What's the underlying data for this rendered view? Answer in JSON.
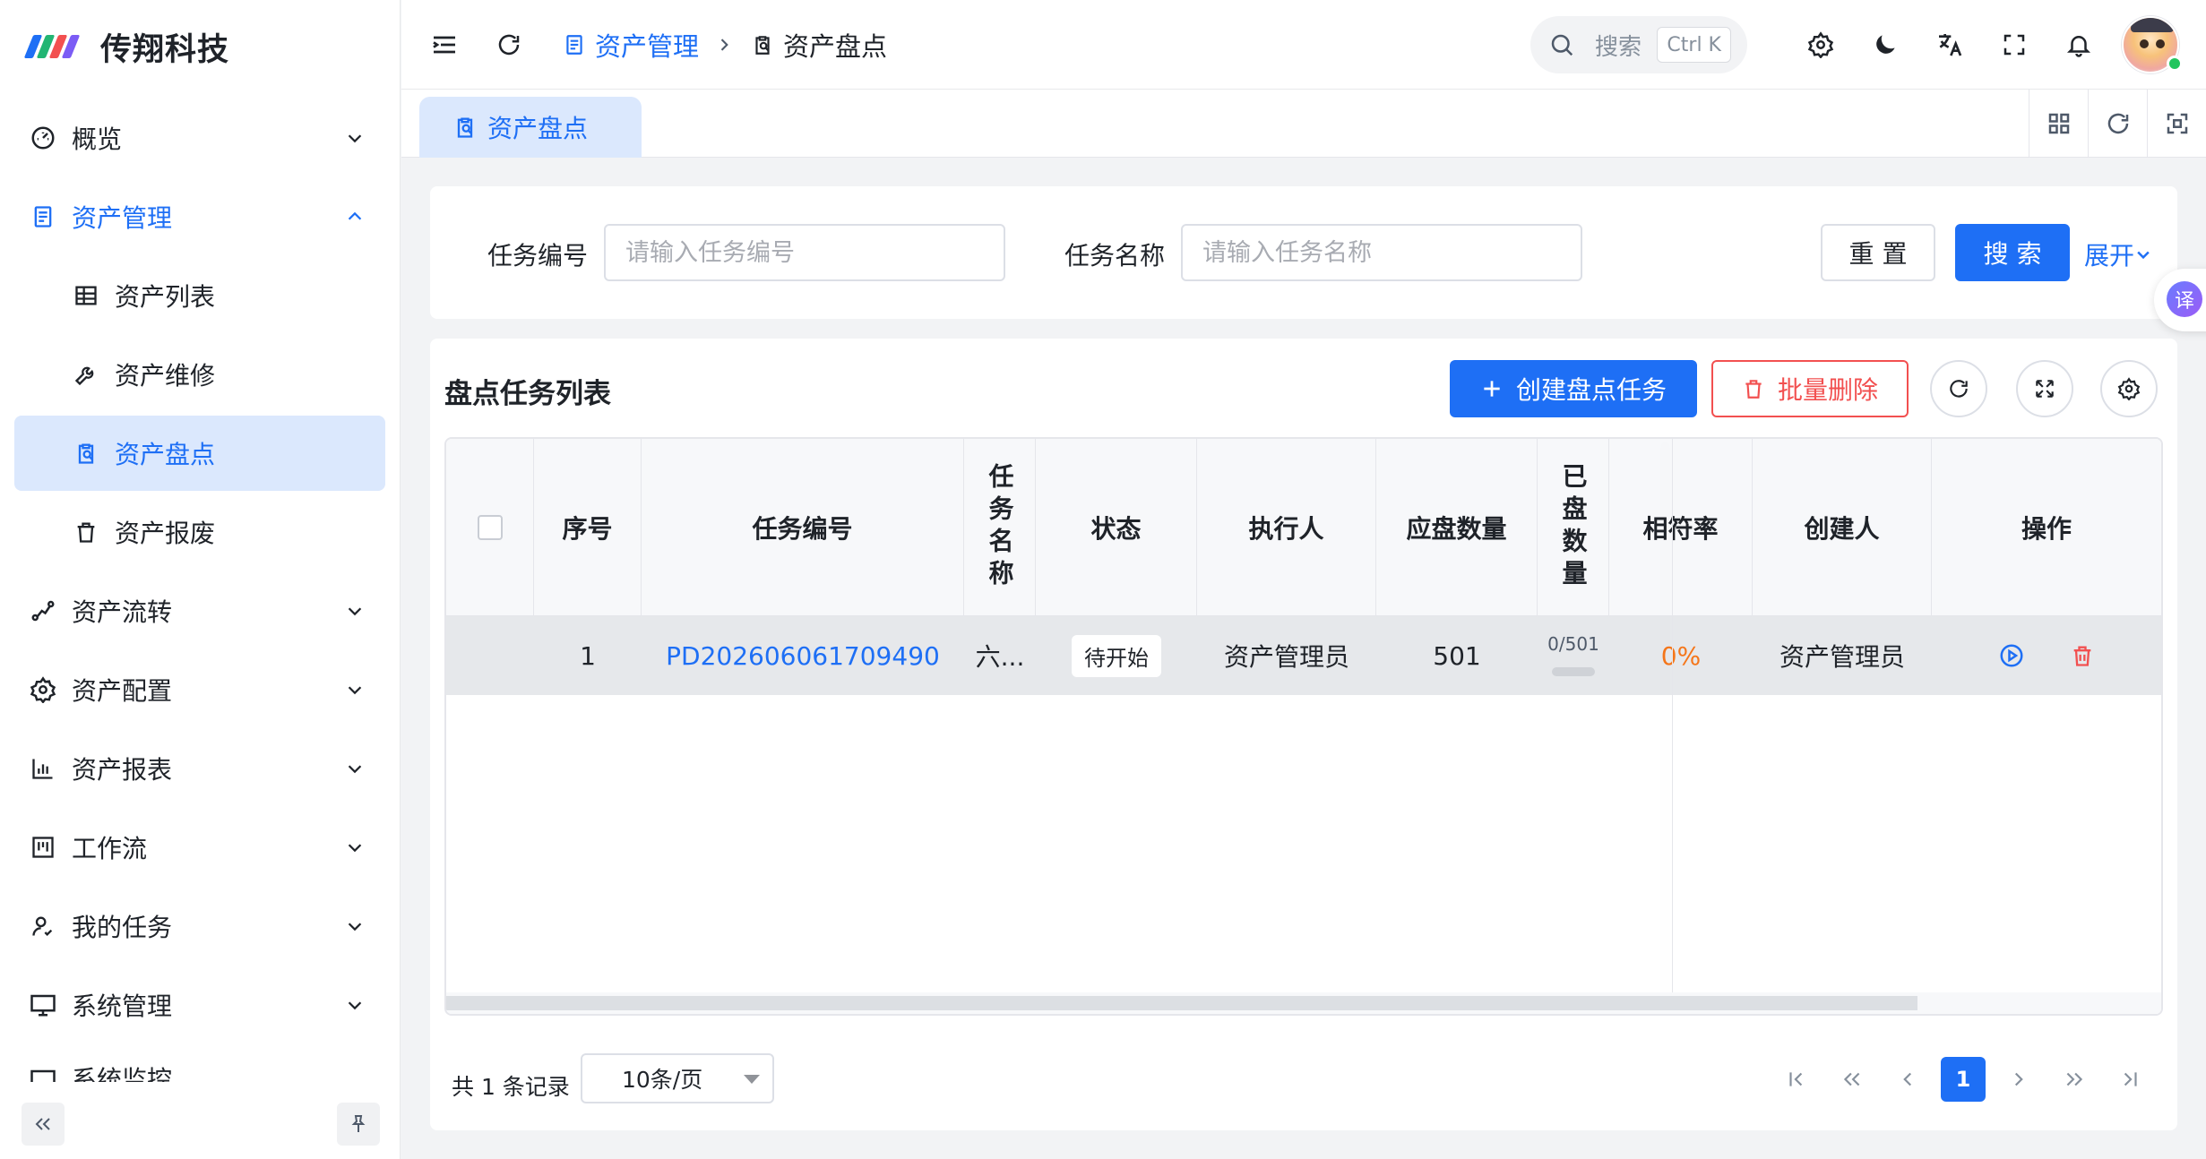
{
  "brand": {
    "name": "传翔科技"
  },
  "sidebar": {
    "items": [
      {
        "label": "概览",
        "icon": "dashboard-icon"
      },
      {
        "label": "资产管理",
        "icon": "document-icon"
      },
      {
        "label": "资产列表",
        "icon": "table-icon"
      },
      {
        "label": "资产维修",
        "icon": "wrench-icon"
      },
      {
        "label": "资产盘点",
        "icon": "clipboard-search-icon"
      },
      {
        "label": "资产报废",
        "icon": "trash-icon"
      },
      {
        "label": "资产流转",
        "icon": "flow-icon"
      },
      {
        "label": "资产配置",
        "icon": "gear-icon"
      },
      {
        "label": "资产报表",
        "icon": "bar-chart-icon"
      },
      {
        "label": "工作流",
        "icon": "kanban-icon"
      },
      {
        "label": "我的任务",
        "icon": "user-task-icon"
      },
      {
        "label": "系统管理",
        "icon": "monitor-icon"
      },
      {
        "label": "系统监控",
        "icon": "monitor-chart-icon"
      }
    ]
  },
  "header": {
    "breadcrumb": [
      "资产管理",
      "资产盘点"
    ],
    "search_placeholder": "搜索",
    "search_shortcut": "Ctrl K"
  },
  "tabs": [
    {
      "label": "资产盘点",
      "active": true
    }
  ],
  "filters": {
    "task_no_label": "任务编号",
    "task_no_placeholder": "请输入任务编号",
    "task_name_label": "任务名称",
    "task_name_placeholder": "请输入任务名称",
    "reset_label": "重 置",
    "search_label": "搜 索",
    "expand_label": "展开"
  },
  "translate_fab": "译",
  "table": {
    "title": "盘点任务列表",
    "create_label": "创建盘点任务",
    "batch_delete_label": "批量删除",
    "columns": [
      "序号",
      "任务编号",
      "任务名称",
      "状态",
      "执行人",
      "应盘数量",
      "已盘数量",
      "相符率",
      "创建人",
      "操作"
    ],
    "rows": [
      {
        "index": "1",
        "task_no": "PD202606061709490",
        "task_name": "六...",
        "status": "待开始",
        "executor": "资产管理员",
        "expected": "501",
        "counted": "0/501",
        "counted_progress": 0,
        "rate": "0%",
        "creator": "资产管理员"
      }
    ]
  },
  "pagination": {
    "total": "共 1 条记录",
    "page_size": "10条/页",
    "current_page": "1"
  },
  "colors": {
    "primary": "#1e6ff5",
    "danger": "#f25050",
    "rate": "#f5761a",
    "active_bg": "#dbe8fd"
  }
}
